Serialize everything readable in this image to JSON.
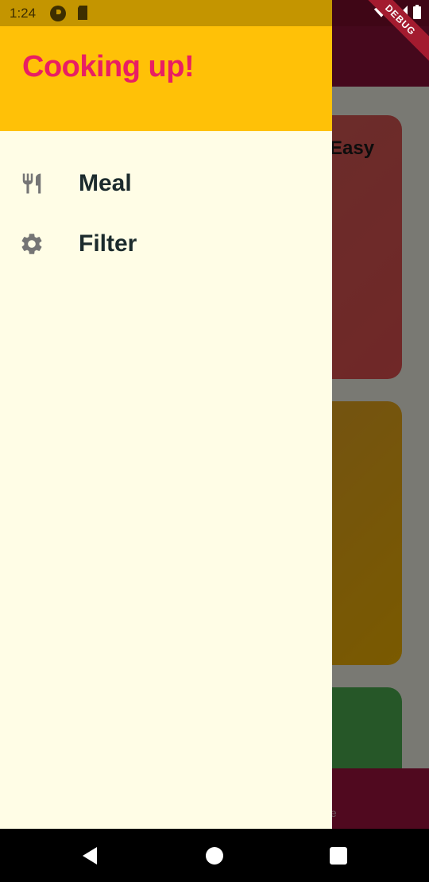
{
  "status_bar": {
    "time": "1:24",
    "icons_left": [
      "app-notification-icon",
      "sd-card-icon"
    ],
    "icons_right": [
      "wifi-icon",
      "signal-icon",
      "battery-icon"
    ]
  },
  "debug_banner": {
    "label": "DEBUG"
  },
  "drawer": {
    "title": "Cooking up!",
    "items": [
      {
        "label": "Meal",
        "icon": "restaurant-icon"
      },
      {
        "label": "Filter",
        "icon": "settings-icon"
      }
    ]
  },
  "background": {
    "card_1_text": "Easy",
    "bottom_label": "te"
  },
  "colors": {
    "header": "#ffc107",
    "title": "#e91e63",
    "drawer_bg": "#fffde6",
    "app_primary": "#8a1038"
  },
  "nav_bar": {
    "buttons": [
      "back",
      "home",
      "recents"
    ]
  }
}
